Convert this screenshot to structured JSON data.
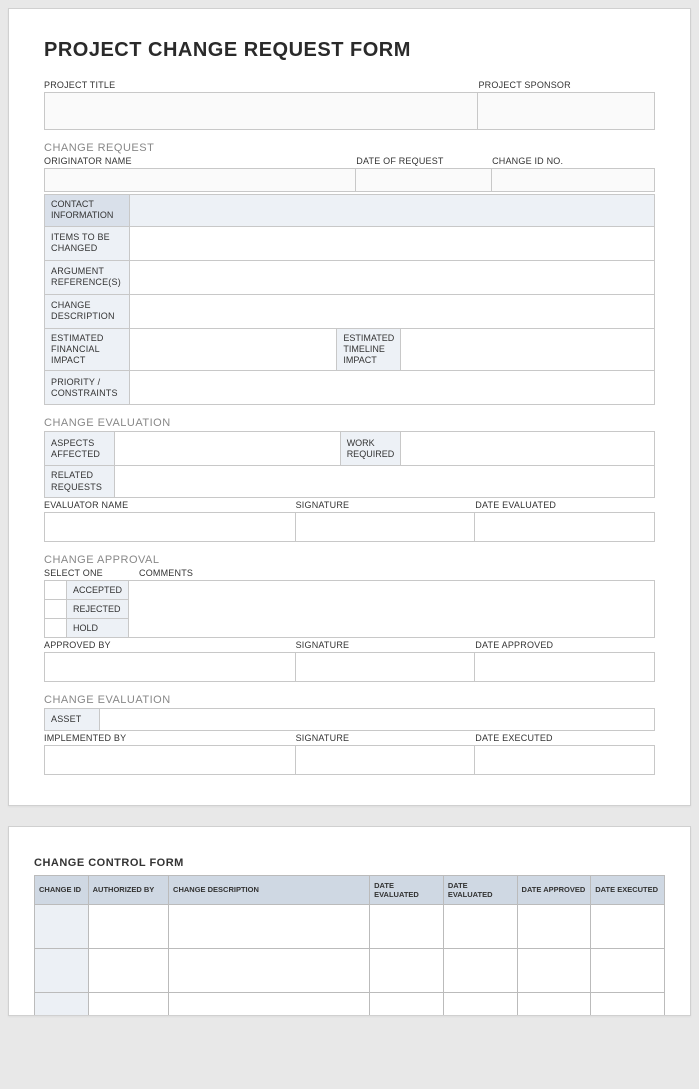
{
  "form1": {
    "title": "PROJECT CHANGE REQUEST FORM",
    "project_title_label": "PROJECT TITLE",
    "project_sponsor_label": "PROJECT SPONSOR",
    "sections": {
      "change_request": "CHANGE REQUEST",
      "change_evaluation": "CHANGE EVALUATION",
      "change_approval": "CHANGE APPROVAL",
      "change_evaluation2": "CHANGE EVALUATION"
    },
    "req": {
      "originator": "ORIGINATOR NAME",
      "date_of_request": "DATE OF REQUEST",
      "change_id": "CHANGE ID NO.",
      "contact_info": "CONTACT INFORMATION",
      "items_to_change": "ITEMS TO BE CHANGED",
      "argument_ref": "ARGUMENT REFERENCE(S)",
      "change_desc": "CHANGE DESCRIPTION",
      "est_financial": "ESTIMATED FINANCIAL IMPACT",
      "est_timeline": "ESTIMATED TIMELINE IMPACT",
      "priority": "PRIORITY / CONSTRAINTS"
    },
    "eval": {
      "aspects": "ASPECTS AFFECTED",
      "work_required": "WORK REQUIRED",
      "related": "RELATED REQUESTS",
      "evaluator": "EVALUATOR NAME",
      "signature": "SIGNATURE",
      "date_eval": "DATE EVALUATED"
    },
    "approval": {
      "select_one": "SELECT ONE",
      "comments": "COMMENTS",
      "accepted": "ACCEPTED",
      "rejected": "REJECTED",
      "hold": "HOLD",
      "approved_by": "APPROVED BY",
      "signature": "SIGNATURE",
      "date_approved": "DATE APPROVED"
    },
    "impl": {
      "asset": "ASSET",
      "implemented_by": "IMPLEMENTED BY",
      "signature": "SIGNATURE",
      "date_executed": "DATE EXECUTED"
    }
  },
  "form2": {
    "title": "CHANGE CONTROL FORM",
    "headers": {
      "change_id": "CHANGE ID",
      "authorized_by": "AUTHORIZED BY",
      "change_desc": "CHANGE DESCRIPTION",
      "date_eval1": "DATE EVALUATED",
      "date_eval2": "DATE EVALUATED",
      "date_approved": "DATE APPROVED",
      "date_executed": "DATE EXECUTED"
    }
  }
}
